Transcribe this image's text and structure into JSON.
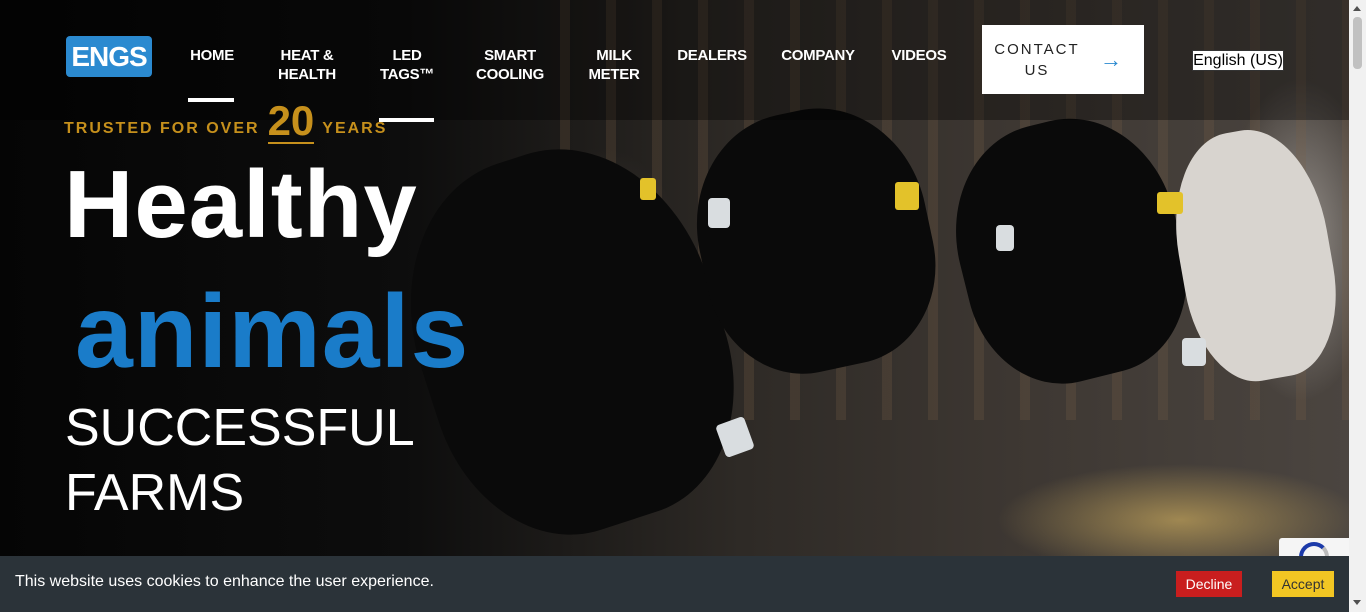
{
  "brand": {
    "logo_text": "ENGS"
  },
  "nav": {
    "items": [
      {
        "line1": "HOME",
        "line2": ""
      },
      {
        "line1": "HEAT &",
        "line2": "HEALTH"
      },
      {
        "line1": "LED",
        "line2": "TAGS™"
      },
      {
        "line1": "SMART",
        "line2": "COOLING"
      },
      {
        "line1": "MILK",
        "line2": "METER"
      },
      {
        "line1": "DEALERS",
        "line2": ""
      },
      {
        "line1": "COMPANY",
        "line2": ""
      },
      {
        "line1": "VIDEOS",
        "line2": ""
      }
    ],
    "contact": {
      "line1": "CONTACT",
      "line2": "US",
      "arrow": "→"
    },
    "language": "English (US)"
  },
  "hero": {
    "trusted_prefix": "TRUSTED FOR OVER",
    "trusted_number": "20",
    "trusted_suffix": "YEARS",
    "headline_1": "Healthy",
    "headline_2": "animals",
    "subhead_1": "SUCCESSFUL",
    "subhead_2": "FARMS"
  },
  "cookie_banner": {
    "message": "This website uses cookies to enhance the user experience.",
    "decline_label": "Decline",
    "accept_label": "Accept"
  },
  "colors": {
    "brand_blue": "#1a7cc9",
    "gold": "#c6901c",
    "decline_red": "#c91e1e",
    "accept_yellow": "#f2c623",
    "cookie_bg": "#2b3339"
  }
}
